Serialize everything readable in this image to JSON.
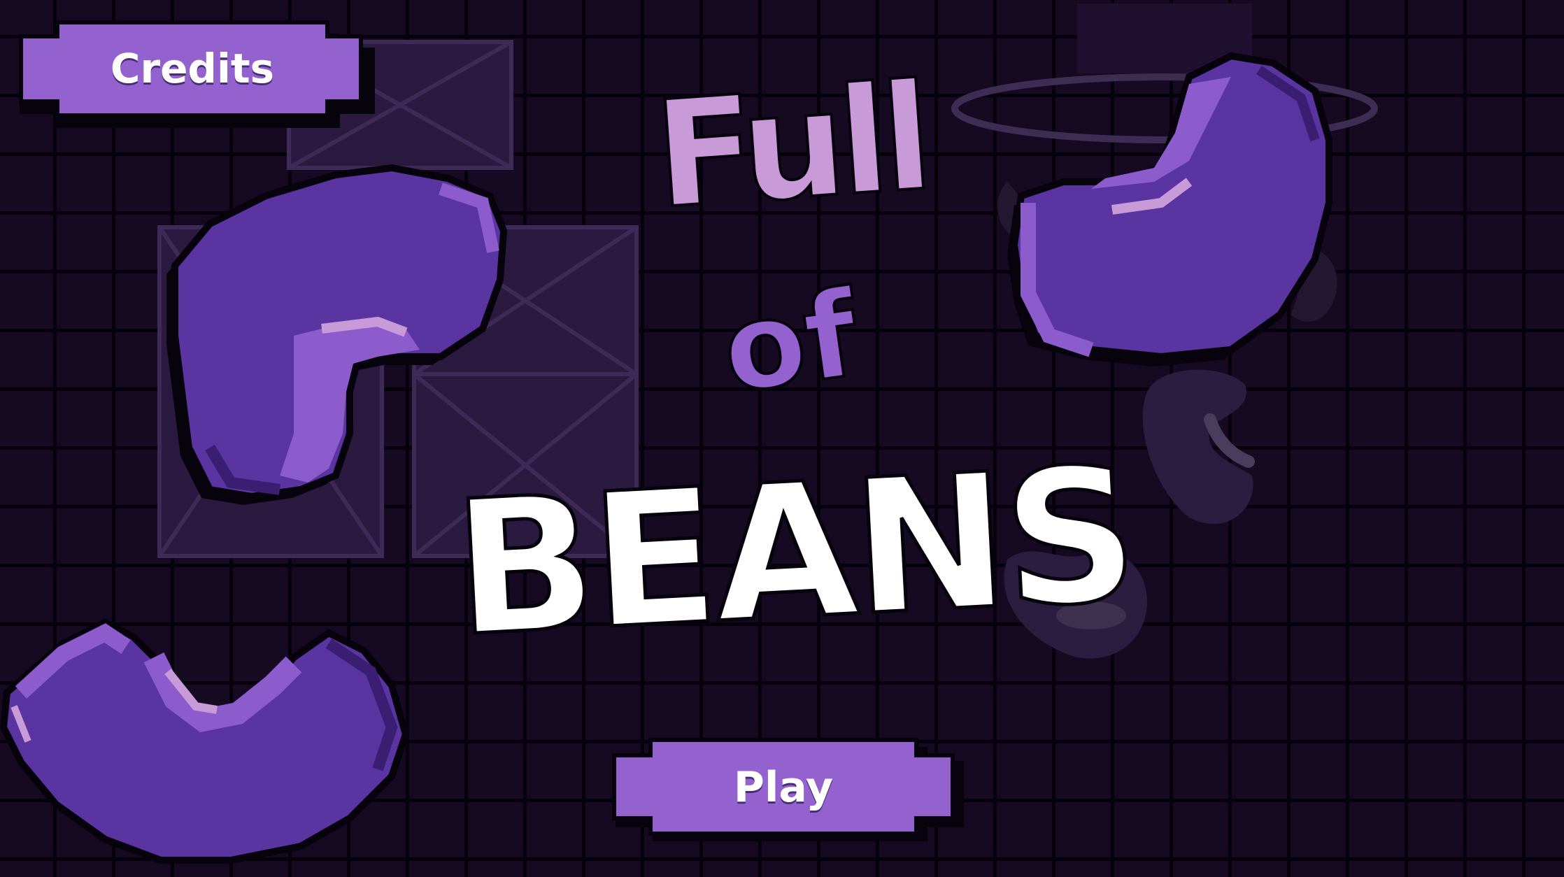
{
  "menu": {
    "credits_label": "Credits",
    "play_label": "Play"
  },
  "title": {
    "line1": "Full",
    "line2": "of",
    "line3": "BEANS"
  },
  "colors": {
    "background": "#150a21",
    "grid_line": "#06020b",
    "button_fill": "#9462cf",
    "button_outline": "#07030d",
    "bean_main": "#5a34a0",
    "bean_light": "#8c5ccd",
    "bean_highlight": "#c89ad8",
    "title_pink": "#c89ad8",
    "title_purple": "#9462cf",
    "title_white": "#ffffff"
  }
}
